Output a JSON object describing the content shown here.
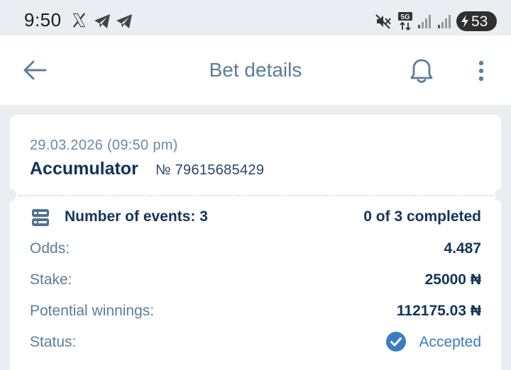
{
  "status_bar": {
    "time": "9:50",
    "battery": "53",
    "network": "5G",
    "icons": [
      "x-icon",
      "telegram-icon",
      "telegram-icon",
      "mute-icon",
      "5g-icon",
      "signal-icon",
      "signal-icon",
      "battery-icon"
    ]
  },
  "header": {
    "title": "Bet details",
    "back_icon": "arrow-left-icon",
    "bell_icon": "bell-icon",
    "more_icon": "more-vertical-icon"
  },
  "bet": {
    "date": "29.03.2026 (09:50 pm)",
    "type": "Accumulator",
    "number": "№ 79615685429",
    "events_label": "Number of events: 3",
    "events_completed": "0 of 3 completed",
    "rows": [
      {
        "label": "Odds:",
        "value": "4.487"
      },
      {
        "label": "Stake:",
        "value": "25000 ₦"
      },
      {
        "label": "Potential winnings:",
        "value": "112175.03 ₦"
      }
    ],
    "status_label": "Status:",
    "status_value": "Accepted"
  },
  "colors": {
    "background": "#eaedf1",
    "title": "#5c7d9b",
    "dark_text": "#14345a",
    "accent": "#3a7cc4"
  }
}
